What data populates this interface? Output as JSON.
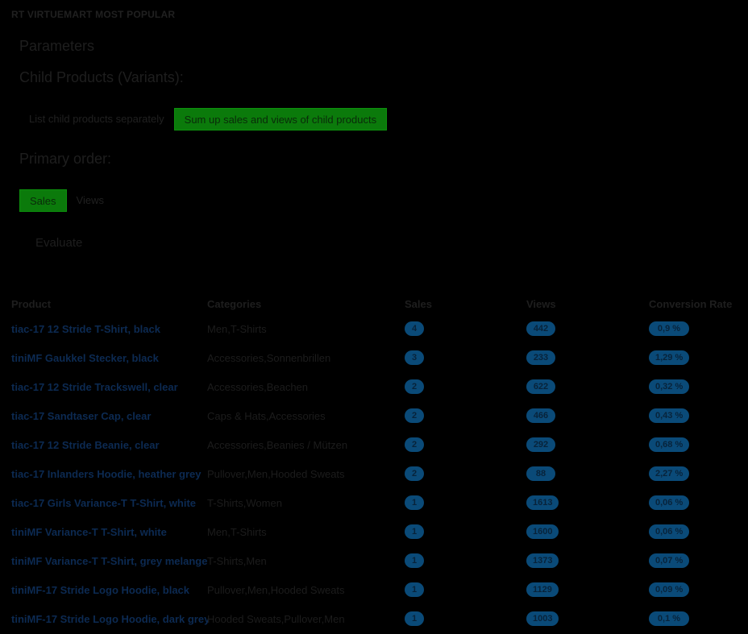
{
  "header": {
    "title": "RT VIRTUEMART MOST POPULAR",
    "parameters": "Parameters",
    "child_products_heading": "Child Products (Variants):",
    "primary_order_heading": "Primary order:"
  },
  "child_products": {
    "options": [
      "List child products separately",
      "Sum up sales and views of child products"
    ],
    "selected": "Sum up sales and views of child products"
  },
  "primary_order": {
    "options": [
      "Sales",
      "Views"
    ],
    "selected": "Sales"
  },
  "evaluate_label": "Evaluate",
  "table": {
    "columns": [
      "Product",
      "Categories",
      "Sales",
      "Views",
      "Conversion Rate"
    ],
    "rows": [
      {
        "product": "tiac-17 12 Stride T-Shirt, black",
        "categories": "Men,T-Shirts",
        "sales": "4",
        "views": "442",
        "conversion": "0,9 %"
      },
      {
        "product": "tiniMF Gaukkel Stecker, black",
        "categories": "Accessories,Sonnenbrillen",
        "sales": "3",
        "views": "233",
        "conversion": "1,29 %"
      },
      {
        "product": "tiac-17 12 Stride Trackswell, clear",
        "categories": "Accessories,Beachen",
        "sales": "2",
        "views": "622",
        "conversion": "0,32 %"
      },
      {
        "product": "tiac-17 Sandtaser Cap, clear",
        "categories": "Caps & Hats,Accessories",
        "sales": "2",
        "views": "466",
        "conversion": "0,43 %"
      },
      {
        "product": "tiac-17 12 Stride Beanie, clear",
        "categories": "Accessories,Beanies / Mützen",
        "sales": "2",
        "views": "292",
        "conversion": "0,68 %"
      },
      {
        "product": "tiac-17 Inlanders Hoodie, heather grey",
        "categories": "Pullover,Men,Hooded Sweats",
        "sales": "2",
        "views": "88",
        "conversion": "2,27 %"
      },
      {
        "product": "tiac-17 Girls Variance-T T-Shirt, white",
        "categories": "T-Shirts,Women",
        "sales": "1",
        "views": "1613",
        "conversion": "0,06 %"
      },
      {
        "product": "tiniMF Variance-T T-Shirt, white",
        "categories": "Men,T-Shirts",
        "sales": "1",
        "views": "1600",
        "conversion": "0,06 %"
      },
      {
        "product": "tiniMF Variance-T T-Shirt, grey melange",
        "categories": "T-Shirts,Men",
        "sales": "1",
        "views": "1373",
        "conversion": "0,07 %"
      },
      {
        "product": "tiniMF-17 Stride Logo Hoodie, black",
        "categories": "Pullover,Men,Hooded Sweats",
        "sales": "1",
        "views": "1129",
        "conversion": "0,09 %"
      },
      {
        "product": "tiniMF-17 Stride Logo Hoodie, dark grey",
        "categories": "Hooded Sweats,Pullover,Men",
        "sales": "1",
        "views": "1003",
        "conversion": "0,1 %"
      }
    ]
  },
  "colors": {
    "background": "#000000",
    "active_toggle": "#0b7a0b",
    "badge": "#0a4a78",
    "link": "#0c2a52"
  }
}
